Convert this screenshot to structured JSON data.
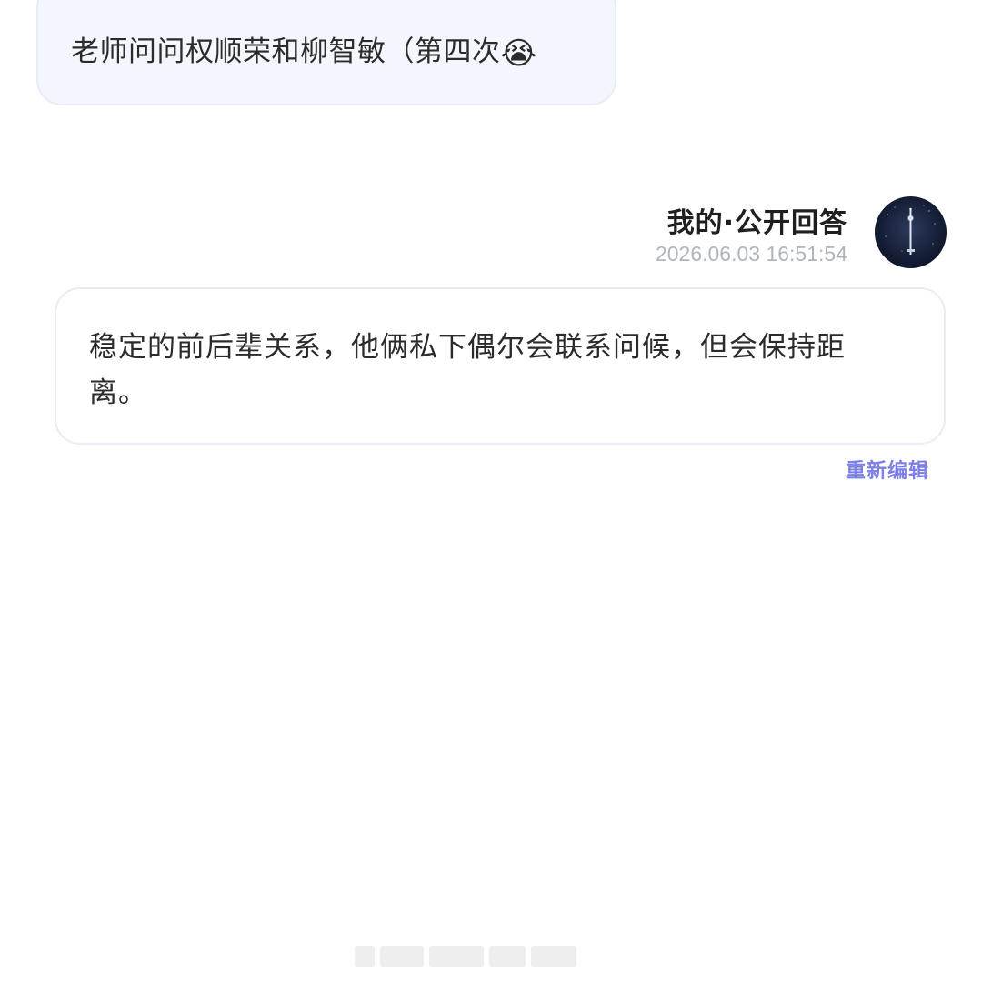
{
  "question": {
    "text": "老师问问权顺荣和柳智敏（第四次",
    "emoji": "😭"
  },
  "answer": {
    "title": "我的·公开回答",
    "timestamp": "2026.06.03 16:51:54",
    "avatar_icon": "moon-tower-avatar",
    "text": "稳定的前后辈关系，他俩私下偶尔会联系问候，但会保持距离。"
  },
  "actions": {
    "edit_label": "重新编辑"
  },
  "colors": {
    "question_bg": "#f3f6fc",
    "edit_accent": "#7c7fe8",
    "timestamp": "#b0b4bc"
  }
}
